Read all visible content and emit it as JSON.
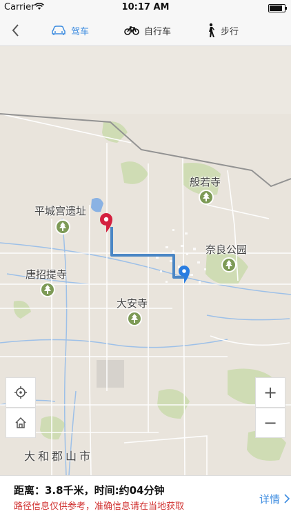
{
  "status_bar": {
    "carrier": "Carrier",
    "time": "10:17 AM",
    "battery_level": 0.95
  },
  "nav": {
    "back_icon": "chevron-left-icon",
    "modes": [
      {
        "label": "驾车",
        "icon": "car-icon",
        "active": true
      },
      {
        "label": "自行车",
        "icon": "bicycle-icon",
        "active": false
      },
      {
        "label": "步行",
        "icon": "walking-person-icon",
        "active": false
      }
    ]
  },
  "map": {
    "pois": [
      {
        "label": "般若寺",
        "icon": "tree-icon"
      },
      {
        "label": "平城宫遗址",
        "icon": "tree-icon"
      },
      {
        "label": "奈良公园",
        "icon": "tree-icon"
      },
      {
        "label": "唐招提寺",
        "icon": "tree-icon"
      },
      {
        "label": "大安寺",
        "icon": "tree-icon"
      }
    ],
    "city_label": "大和郡山市",
    "route_color": "#4a86c5",
    "start_marker_color": "#d4203f",
    "end_marker_color": "#2a7de1"
  },
  "controls": {
    "locate_icon": "locate-crosshair-icon",
    "home_icon": "home-icon",
    "zoom_in": "+",
    "zoom_out": "−"
  },
  "info": {
    "distance_text": "距离：3.8千米，时间:约04分钟",
    "notice": "路径信息仅供参考，准确信息请在当地获取",
    "details_label": "详情",
    "details_icon": "chevron-right-icon"
  },
  "colors": {
    "accent": "#3d8ce0",
    "warning": "#d0302f"
  }
}
